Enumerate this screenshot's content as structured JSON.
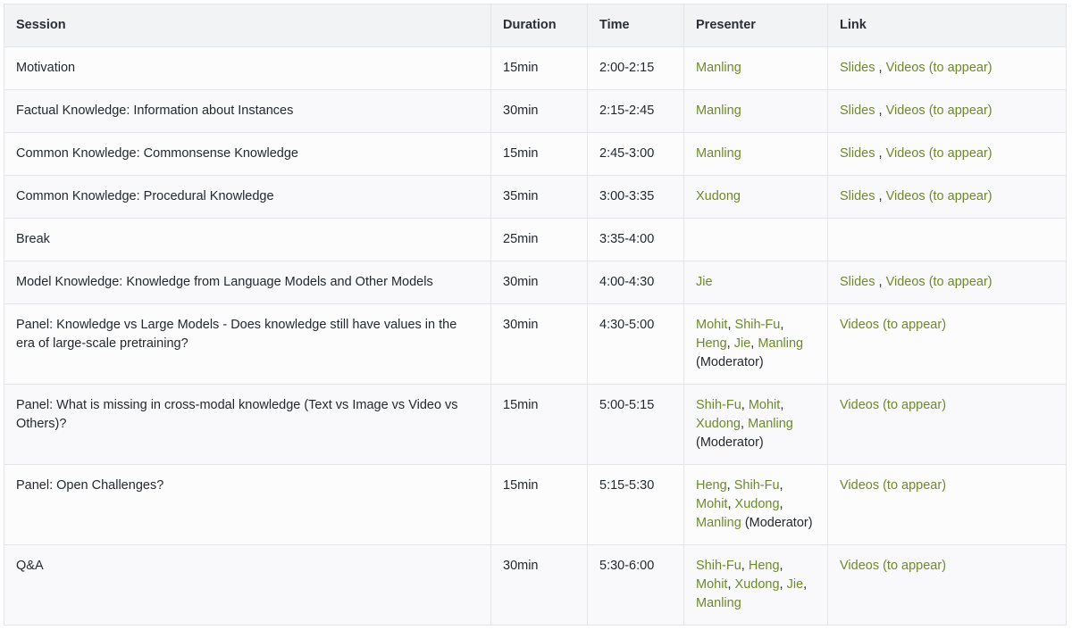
{
  "headers": {
    "session": "Session",
    "duration": "Duration",
    "time": "Time",
    "presenter": "Presenter",
    "link": "Link"
  },
  "colors": {
    "link": "#6d8a2b",
    "header_bg": "#f2f3f5",
    "border": "#e3e5e9",
    "text": "#24292f"
  },
  "rows": [
    {
      "session": "Motivation",
      "duration": "15min",
      "time": "2:00-2:15",
      "presenters": [
        {
          "name": "Manling"
        }
      ],
      "presenter_note": "",
      "links": [
        {
          "text": "Slides"
        },
        {
          "text": "Videos (to appear)"
        }
      ]
    },
    {
      "session": "Factual Knowledge: Information about Instances",
      "duration": "30min",
      "time": "2:15-2:45",
      "presenters": [
        {
          "name": "Manling"
        }
      ],
      "presenter_note": "",
      "links": [
        {
          "text": "Slides"
        },
        {
          "text": "Videos (to appear)"
        }
      ]
    },
    {
      "session": "Common Knowledge: Commonsense Knowledge",
      "duration": "15min",
      "time": "2:45-3:00",
      "presenters": [
        {
          "name": "Manling"
        }
      ],
      "presenter_note": "",
      "links": [
        {
          "text": "Slides"
        },
        {
          "text": "Videos (to appear)"
        }
      ]
    },
    {
      "session": "Common Knowledge: Procedural Knowledge",
      "duration": "35min",
      "time": "3:00-3:35",
      "presenters": [
        {
          "name": "Xudong"
        }
      ],
      "presenter_note": "",
      "links": [
        {
          "text": "Slides"
        },
        {
          "text": "Videos (to appear)"
        }
      ]
    },
    {
      "session": "Break",
      "duration": "25min",
      "time": "3:35-4:00",
      "presenters": [],
      "presenter_note": "",
      "links": []
    },
    {
      "session": "Model Knowledge: Knowledge from Language Models and Other Models",
      "duration": "30min",
      "time": "4:00-4:30",
      "presenters": [
        {
          "name": "Jie"
        }
      ],
      "presenter_note": "",
      "links": [
        {
          "text": "Slides"
        },
        {
          "text": "Videos (to appear)"
        }
      ]
    },
    {
      "session": "Panel: Knowledge vs Large Models - Does knowledge still have values in the era of large-scale pretraining?",
      "duration": "30min",
      "time": "4:30-5:00",
      "presenters": [
        {
          "name": "Mohit"
        },
        {
          "name": "Shih-Fu"
        },
        {
          "name": "Heng"
        },
        {
          "name": "Jie"
        },
        {
          "name": "Manling"
        }
      ],
      "presenter_note": "(Moderator)",
      "links": [
        {
          "text": "Videos (to appear)"
        }
      ]
    },
    {
      "session": "Panel: What is missing in cross-modal knowledge (Text vs Image vs Video vs Others)?",
      "duration": "15min",
      "time": "5:00-5:15",
      "presenters": [
        {
          "name": "Shih-Fu"
        },
        {
          "name": "Mohit"
        },
        {
          "name": "Xudong"
        },
        {
          "name": "Manling"
        }
      ],
      "presenter_note": "(Moderator)",
      "links": [
        {
          "text": "Videos (to appear)"
        }
      ]
    },
    {
      "session": "Panel: Open Challenges?",
      "duration": "15min",
      "time": "5:15-5:30",
      "presenters": [
        {
          "name": "Heng"
        },
        {
          "name": "Shih-Fu"
        },
        {
          "name": "Mohit"
        },
        {
          "name": "Xudong"
        },
        {
          "name": "Manling"
        }
      ],
      "presenter_note": "(Moderator)",
      "links": [
        {
          "text": "Videos (to appear)"
        }
      ]
    },
    {
      "session": "Q&A",
      "duration": "30min",
      "time": "5:30-6:00",
      "presenters": [
        {
          "name": "Shih-Fu"
        },
        {
          "name": "Heng"
        },
        {
          "name": "Mohit"
        },
        {
          "name": "Xudong"
        },
        {
          "name": "Jie"
        },
        {
          "name": "Manling"
        }
      ],
      "presenter_note": "",
      "links": [
        {
          "text": "Videos (to appear)"
        }
      ]
    }
  ]
}
